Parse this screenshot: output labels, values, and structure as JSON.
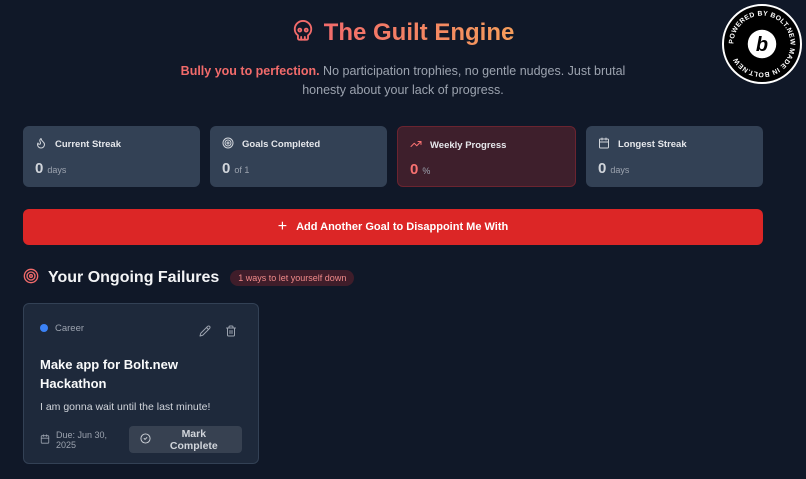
{
  "header": {
    "title": "The Guilt Engine",
    "subtitle_highlight": "Bully you to perfection.",
    "subtitle_rest": " No participation trophies, no gentle nudges. Just brutal honesty about your lack of progress.",
    "icon": "skull-icon"
  },
  "badge": {
    "text": "POWERED BY BOLT.NEW MADE IN BOLT.NEW",
    "letter": "b"
  },
  "stats": [
    {
      "label": "Current Streak",
      "value": "0",
      "unit": "days",
      "icon": "flame-icon"
    },
    {
      "label": "Goals Completed",
      "value": "0",
      "unit": "of 1",
      "icon": "target-icon"
    },
    {
      "label": "Weekly Progress",
      "value": "0",
      "unit": "%",
      "icon": "trending-up-icon"
    },
    {
      "label": "Longest Streak",
      "value": "0",
      "unit": "days",
      "icon": "calendar-icon"
    }
  ],
  "add_button": {
    "label": "Add Another Goal to Disappoint Me With"
  },
  "section": {
    "title": "Your Ongoing Failures",
    "badge": "1 ways to let yourself down"
  },
  "goal": {
    "category": "Career",
    "title": "Make app for Bolt.new Hackathon",
    "description": "I am gonna wait until the last minute!",
    "due": "Due: Jun 30, 2025",
    "action": "Mark Complete"
  },
  "colors": {
    "background": "#101828",
    "accent_red": "#dc2626",
    "title_gradient_start": "#f26b6b",
    "title_gradient_end": "#f59d5b",
    "category_dot": "#3b82f6"
  }
}
